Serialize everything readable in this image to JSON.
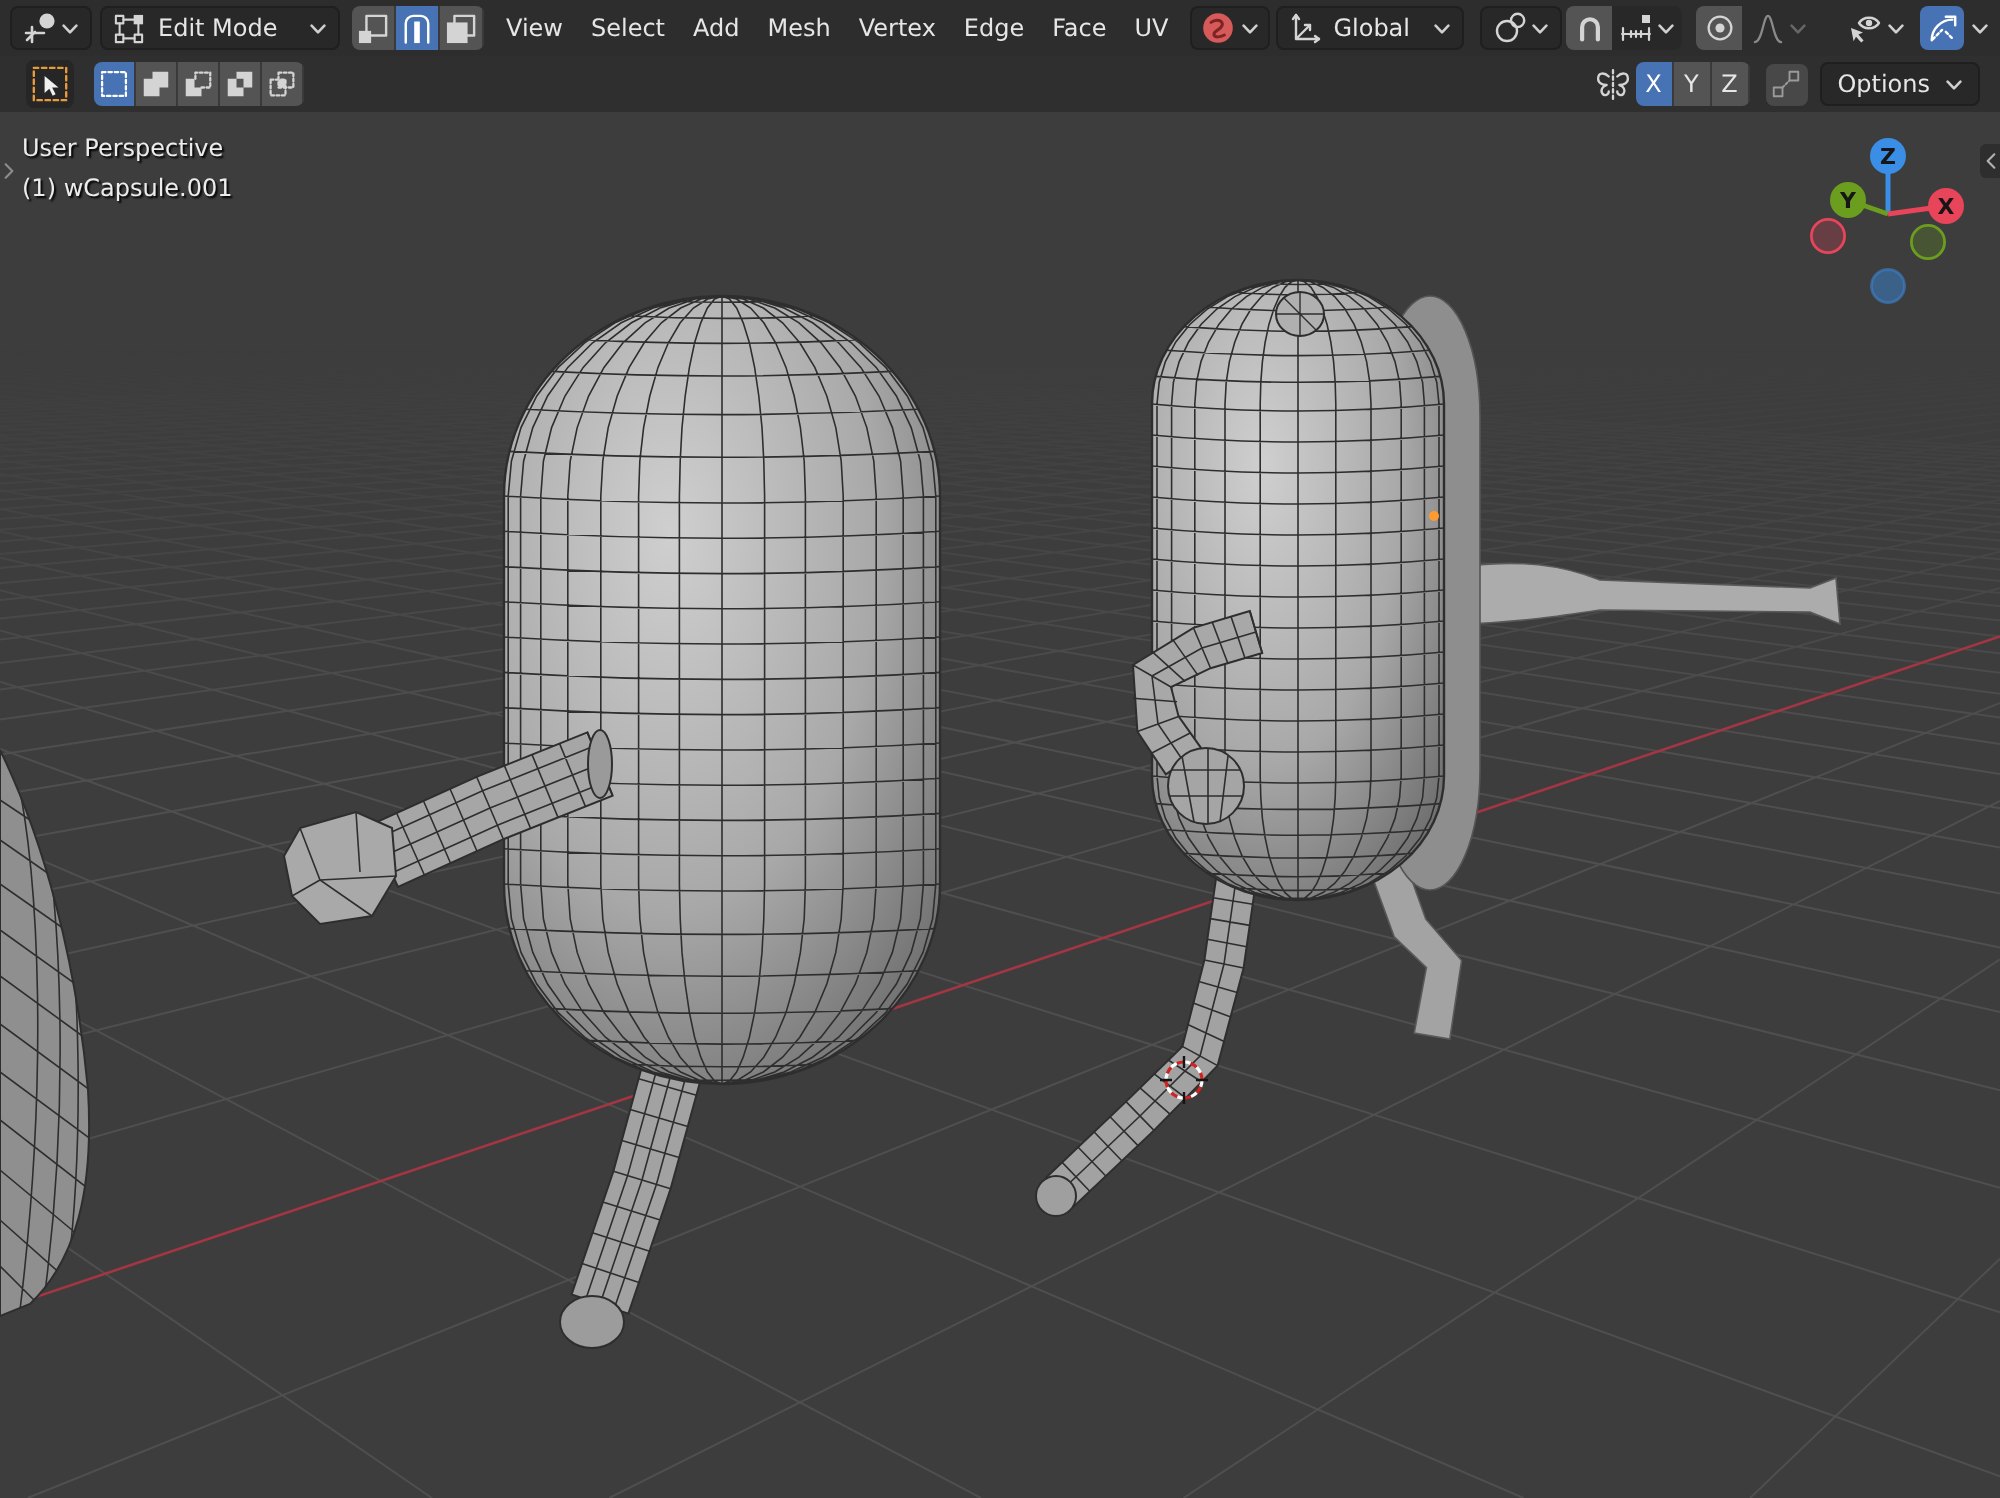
{
  "header": {
    "mode": {
      "label": "Edit Mode"
    },
    "select_modes": [
      {
        "kind": "vertex",
        "selected": false
      },
      {
        "kind": "edge",
        "selected": true
      },
      {
        "kind": "face",
        "selected": false
      }
    ],
    "menus": [
      "View",
      "Select",
      "Add",
      "Mesh",
      "Vertex",
      "Edge",
      "Face",
      "UV"
    ],
    "orientation": {
      "label": "Global"
    },
    "snap": {
      "on": false
    },
    "proportional_editing": {
      "on": false
    },
    "gizmos": {
      "on": true
    }
  },
  "tool_settings": {
    "selection_modes": [
      {
        "kind": "set",
        "selected": true
      },
      {
        "kind": "extend",
        "selected": false
      },
      {
        "kind": "subtract",
        "selected": false
      },
      {
        "kind": "difference",
        "selected": false
      },
      {
        "kind": "intersect",
        "selected": false
      }
    ],
    "mirror_axes": [
      {
        "label": "X",
        "selected": true
      },
      {
        "label": "Y",
        "selected": false
      },
      {
        "label": "Z",
        "selected": false
      }
    ],
    "auto_merge": {
      "on": false
    },
    "options": {
      "label": "Options"
    }
  },
  "viewport": {
    "view_name": "User Perspective",
    "object_name": "(1) wCapsule.001",
    "gizmo_axes": [
      {
        "label": "Z",
        "color": "#3a8ee6"
      },
      {
        "label": "Y",
        "color": "#6b9e1f"
      },
      {
        "label": "X",
        "color": "#e8445a"
      }
    ]
  }
}
